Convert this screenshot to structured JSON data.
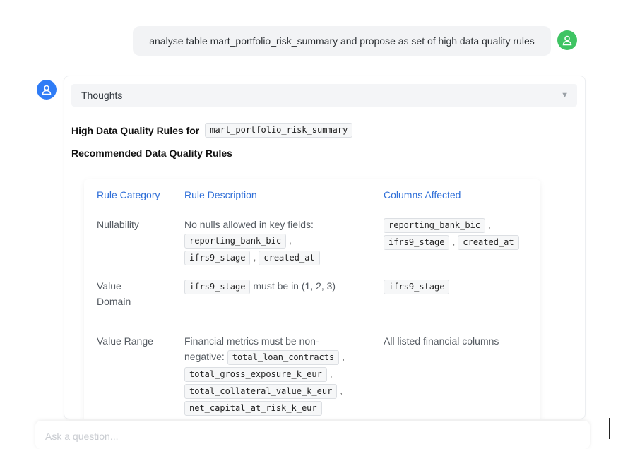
{
  "user_message": "analyse table mart_portfolio_risk_summary and propose as set of high data quality rules",
  "thoughts": {
    "label": "Thoughts"
  },
  "heading1": {
    "text": "High Data Quality Rules for",
    "code": "mart_portfolio_risk_summary"
  },
  "heading2": "Recommended Data Quality Rules",
  "table": {
    "headers": [
      "Rule Category",
      "Rule Description",
      "Columns Affected"
    ],
    "rows": [
      {
        "category": "Nullability",
        "desc_text": "No nulls allowed in key fields:",
        "desc_codes": [
          "reporting_bank_bic",
          "ifrs9_stage",
          "created_at"
        ],
        "columns": [
          "reporting_bank_bic",
          "ifrs9_stage",
          "created_at"
        ]
      },
      {
        "category_line1": "Value",
        "category_line2": "Domain",
        "desc_code": "ifrs9_stage",
        "desc_text": "must be in (1, 2, 3)",
        "columns": [
          "ifrs9_stage"
        ]
      },
      {
        "category": "Value Range",
        "desc_text_line1": "Financial metrics must be non-",
        "desc_text_line2": "negative:",
        "desc_codes": [
          "total_loan_contracts",
          "total_gross_exposure_k_eur",
          "total_collateral_value_k_eur",
          "net_capital_at_risk_k_eur"
        ],
        "columns_text": "All listed financial columns"
      }
    ]
  },
  "input": {
    "placeholder": "Ask a question..."
  },
  "colors": {
    "accent": "#2f6fd8",
    "user_avatar": "#3fc463",
    "bot_avatar": "#2f7cf6"
  },
  "icons": {
    "user_avatar": "user-icon",
    "bot_avatar": "user-icon",
    "thoughts_toggle": "triangle-down-icon"
  }
}
